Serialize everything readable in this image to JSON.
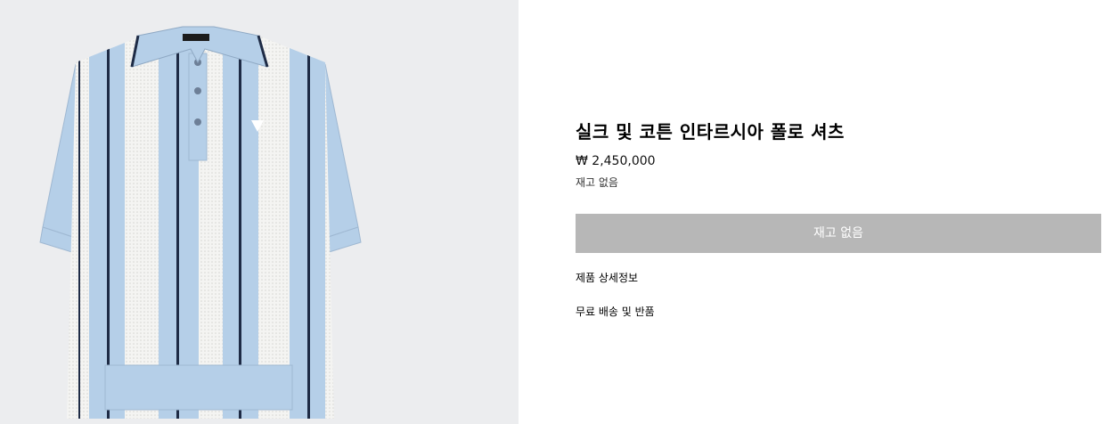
{
  "product": {
    "image_alt": "product-image",
    "title": "실크 및 코튼 인타르시아 폴로 셔츠",
    "price": "₩ 2,450,000",
    "stock_status": "재고 없음",
    "soldout_button_label": "재고 없음",
    "links": {
      "details": "제품 상세정보",
      "shipping_returns": "무료 배송 및 반품"
    }
  },
  "colors": {
    "image_background": "#ecedef",
    "shirt_blue": "#b5cfe8",
    "shirt_white": "#f4f4f2",
    "stripe_navy": "#1e2b45",
    "soldout_button": "#b7b7b7"
  }
}
